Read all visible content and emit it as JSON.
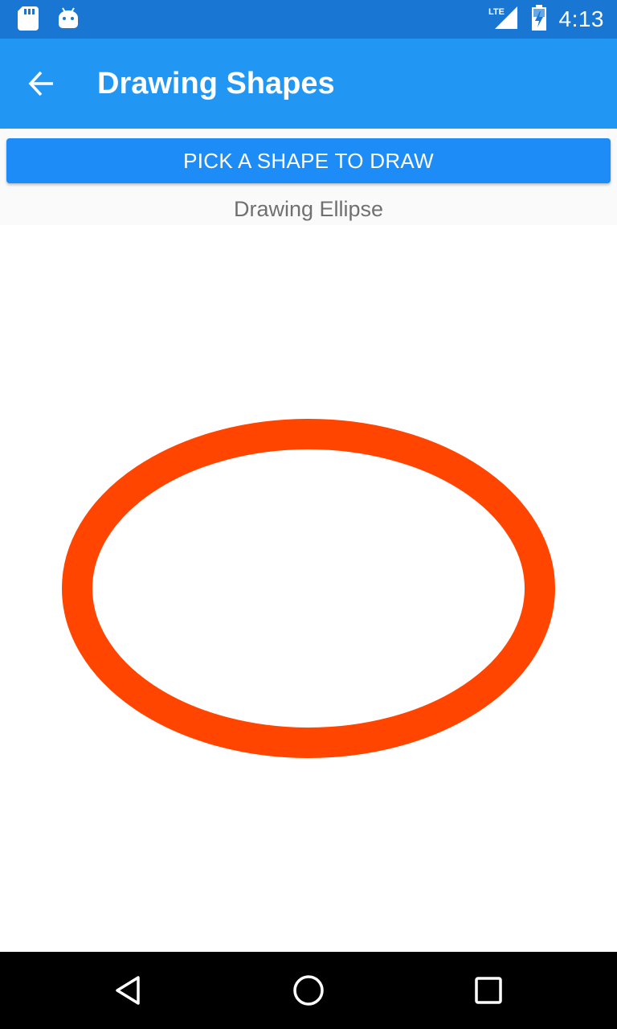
{
  "status_bar": {
    "time": "4:13",
    "network": "LTE",
    "icons": [
      "sd-card-icon",
      "android-debug-icon",
      "signal-icon",
      "battery-charging-icon"
    ]
  },
  "app_bar": {
    "title": "Drawing Shapes",
    "back_icon": "arrow-back-icon"
  },
  "content": {
    "pick_button_label": "PICK A SHAPE TO DRAW",
    "status_text": "Drawing Ellipse"
  },
  "shape": {
    "type": "ellipse",
    "stroke_color": "#FF4500",
    "fill": "none"
  },
  "colors": {
    "status_bar": "#1976D2",
    "app_bar": "#2196F3",
    "button": "#1E8CF7"
  },
  "nav_bar": {
    "icons": [
      "back-triangle-icon",
      "home-circle-icon",
      "recents-square-icon"
    ]
  }
}
